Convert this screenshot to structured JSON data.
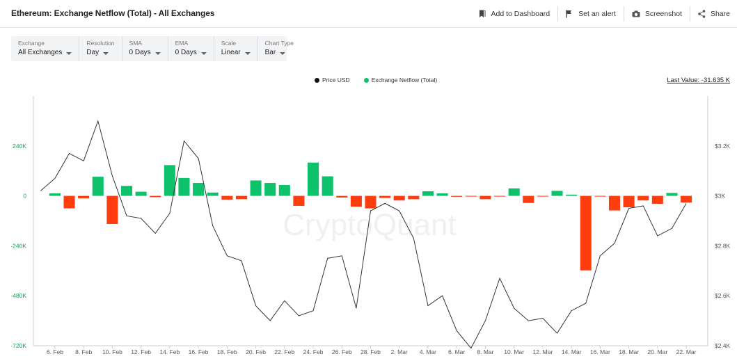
{
  "header": {
    "title": "Ethereum: Exchange Netflow (Total) - All Exchanges",
    "actions": [
      {
        "label": "Add to Dashboard",
        "icon": "bookmark-icon"
      },
      {
        "label": "Set an alert",
        "icon": "bell-icon"
      },
      {
        "label": "Screenshot",
        "icon": "camera-icon"
      },
      {
        "label": "Share",
        "icon": "share-icon"
      }
    ]
  },
  "controls": [
    {
      "label": "Exchange",
      "value": "All Exchanges"
    },
    {
      "label": "Resolution",
      "value": "Day"
    },
    {
      "label": "SMA",
      "value": "0 Days"
    },
    {
      "label": "EMA",
      "value": "0 Days"
    },
    {
      "label": "Scale",
      "value": "Linear"
    },
    {
      "label": "Chart Type",
      "value": "Bar"
    }
  ],
  "legend": {
    "price": "Price USD",
    "netflow": "Exchange Netflow (Total)",
    "last_value": "Last Value: -31.635 K"
  },
  "watermark": "CryptoQuant",
  "colors": {
    "positive": "#0dc26b",
    "negative": "#ff3d0f",
    "price_line": "#333333",
    "left_axis_text": "#12a85a"
  },
  "chart_data": {
    "type": "bar",
    "x": [
      "5. Feb",
      "6. Feb",
      "7. Feb",
      "8. Feb",
      "9. Feb",
      "10. Feb",
      "11. Feb",
      "12. Feb",
      "13. Feb",
      "14. Feb",
      "15. Feb",
      "16. Feb",
      "17. Feb",
      "18. Feb",
      "19. Feb",
      "20. Feb",
      "21. Feb",
      "22. Feb",
      "23. Feb",
      "24. Feb",
      "25. Feb",
      "26. Feb",
      "27. Feb",
      "28. Feb",
      "1. Mar",
      "2. Mar",
      "3. Mar",
      "4. Mar",
      "5. Mar",
      "6. Mar",
      "7. Mar",
      "8. Mar",
      "9. Mar",
      "10. Mar",
      "11. Mar",
      "12. Mar",
      "13. Mar",
      "14. Mar",
      "15. Mar",
      "16. Mar",
      "17. Mar",
      "18. Mar",
      "19. Mar",
      "20. Mar",
      "21. Mar",
      "22. Mar",
      "23. Mar"
    ],
    "x_tick_labels": [
      "6. Feb",
      "8. Feb",
      "10. Feb",
      "12. Feb",
      "14. Feb",
      "16. Feb",
      "18. Feb",
      "20. Feb",
      "22. Feb",
      "24. Feb",
      "26. Feb",
      "28. Feb",
      "2. Mar",
      "4. Mar",
      "6. Mar",
      "8. Mar",
      "10. Mar",
      "12. Mar",
      "14. Mar",
      "16. Mar",
      "18. Mar",
      "20. Mar",
      "22. Mar"
    ],
    "series": [
      {
        "name": "Exchange Netflow (Total)",
        "axis": "left",
        "values": [
          null,
          12000,
          -60000,
          -12000,
          92000,
          -135000,
          48000,
          20000,
          -6000,
          148000,
          86000,
          62000,
          16000,
          -18000,
          -16000,
          74000,
          62000,
          52000,
          -48000,
          160000,
          94000,
          -8000,
          -52000,
          -60000,
          -10000,
          -22000,
          -16000,
          22000,
          12000,
          -4000,
          -3000,
          -16000,
          -3000,
          36000,
          -34000,
          -3000,
          24000,
          6000,
          -358000,
          -3000,
          -70000,
          -55000,
          -22000,
          -38000,
          14000,
          -32000,
          null
        ]
      },
      {
        "name": "Price USD",
        "axis": "right",
        "values": [
          3020,
          3070,
          3170,
          3140,
          3300,
          3080,
          2920,
          2910,
          2850,
          2930,
          3220,
          3150,
          2880,
          2760,
          2740,
          2560,
          2500,
          2580,
          2520,
          2540,
          2750,
          2760,
          2550,
          2940,
          2970,
          2940,
          2830,
          2560,
          2600,
          2460,
          2390,
          2500,
          2670,
          2550,
          2500,
          2510,
          2450,
          2540,
          2570,
          2760,
          2810,
          2950,
          2960,
          2840,
          2870,
          2970,
          null
        ]
      }
    ],
    "y_left": {
      "ticks": [
        "240K",
        "0",
        "-240K",
        "-480K",
        "-720K"
      ],
      "tick_values": [
        240000,
        0,
        -240000,
        -480000,
        -720000
      ],
      "range": [
        -720000,
        480000
      ]
    },
    "y_right": {
      "ticks": [
        "$3.2K",
        "$3K",
        "$2.8K",
        "$2.6K",
        "$2.4K"
      ],
      "tick_values": [
        3200,
        3000,
        2800,
        2600,
        2400
      ],
      "range": [
        2400,
        3400
      ]
    },
    "grid": false
  }
}
